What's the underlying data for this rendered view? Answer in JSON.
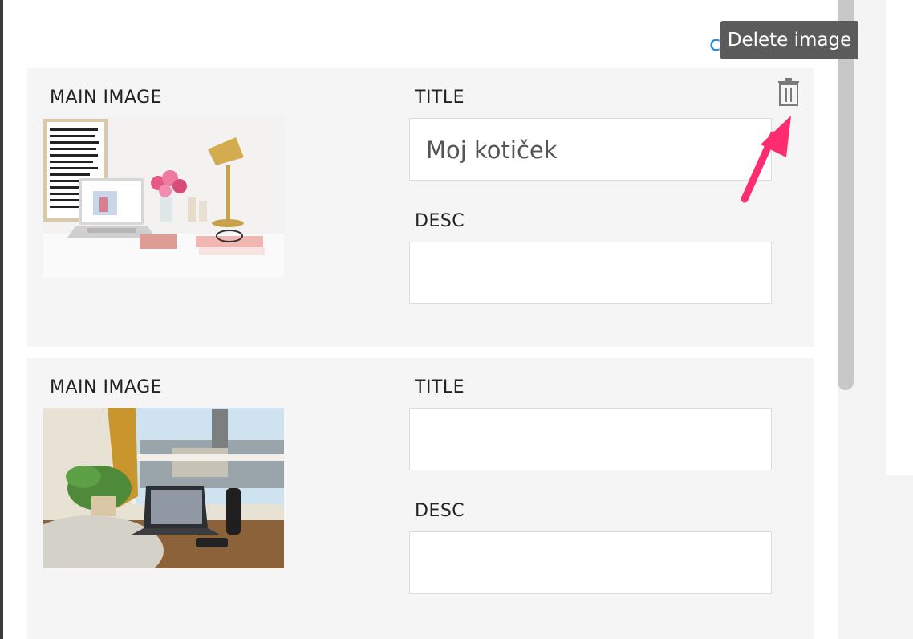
{
  "partial_link_char": "c",
  "tooltip": {
    "text": "Delete image"
  },
  "cards": [
    {
      "main_image_label": "MAIN IMAGE",
      "title_label": "TITLE",
      "title_value": "Moj kotiček",
      "desc_label": "DESC",
      "desc_value": ""
    },
    {
      "main_image_label": "MAIN IMAGE",
      "title_label": "TITLE",
      "title_value": "",
      "desc_label": "DESC",
      "desc_value": ""
    }
  ],
  "colors": {
    "card_bg": "#f5f5f5",
    "tooltip_bg": "#5b5b5b",
    "arrow": "#ff2d6f",
    "link": "#1e88e5"
  },
  "icons": [
    "trash-icon",
    "annotation-arrow"
  ]
}
